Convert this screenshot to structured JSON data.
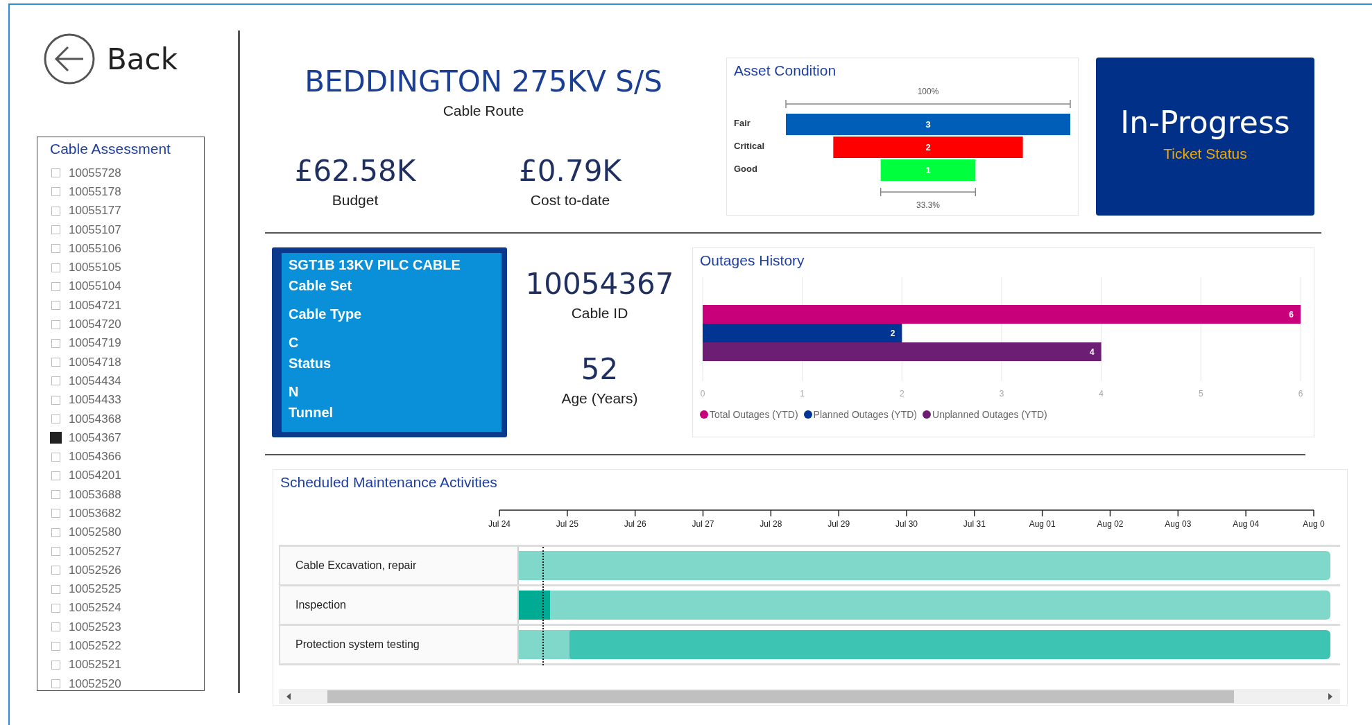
{
  "back_button": {
    "label": "Back"
  },
  "slicer": {
    "title": "Cable Assessment",
    "items": [
      {
        "label": "10055728",
        "checked": false
      },
      {
        "label": "10055178",
        "checked": false
      },
      {
        "label": "10055177",
        "checked": false
      },
      {
        "label": "10055107",
        "checked": false
      },
      {
        "label": "10055106",
        "checked": false
      },
      {
        "label": "10055105",
        "checked": false
      },
      {
        "label": "10055104",
        "checked": false
      },
      {
        "label": "10054721",
        "checked": false
      },
      {
        "label": "10054720",
        "checked": false
      },
      {
        "label": "10054719",
        "checked": false
      },
      {
        "label": "10054718",
        "checked": false
      },
      {
        "label": "10054434",
        "checked": false
      },
      {
        "label": "10054433",
        "checked": false
      },
      {
        "label": "10054368",
        "checked": false
      },
      {
        "label": "10054367",
        "checked": true
      },
      {
        "label": "10054366",
        "checked": false
      },
      {
        "label": "10054201",
        "checked": false
      },
      {
        "label": "10053688",
        "checked": false
      },
      {
        "label": "10053682",
        "checked": false
      },
      {
        "label": "10052580",
        "checked": false
      },
      {
        "label": "10052527",
        "checked": false
      },
      {
        "label": "10052526",
        "checked": false
      },
      {
        "label": "10052525",
        "checked": false
      },
      {
        "label": "10052524",
        "checked": false
      },
      {
        "label": "10052523",
        "checked": false
      },
      {
        "label": "10052522",
        "checked": false
      },
      {
        "label": "10052521",
        "checked": false
      },
      {
        "label": "10052520",
        "checked": false
      }
    ]
  },
  "header": {
    "title": "BEDDINGTON 275KV S/S",
    "subtitle": "Cable Route"
  },
  "kpis": [
    {
      "value": "£62.58K",
      "label": "Budget"
    },
    {
      "value": "£0.79K",
      "label": "Cost to-date"
    }
  ],
  "asset_condition": {
    "title": "Asset Condition",
    "top_percent": "100%",
    "stages": [
      {
        "label": "Fair",
        "value": "3",
        "color": "#005eb8"
      },
      {
        "label": "Critical",
        "value": "2",
        "color": "#ff0000"
      },
      {
        "label": "Good",
        "value": "1",
        "color": "#00ff3c"
      }
    ],
    "bottom_percent": "33.3%"
  },
  "ticket": {
    "value": "In-Progress",
    "label": "Ticket Status"
  },
  "cable_card": {
    "fields": [
      {
        "value": "SGT1B 13KV PILC CABLE",
        "label": "Cable Set"
      },
      {
        "label": "Cable Type"
      },
      {
        "value": "C",
        "label": "Status"
      },
      {
        "value": "N",
        "label": "Tunnel"
      }
    ]
  },
  "cable_id": {
    "value": "10054367",
    "label": "Cable ID"
  },
  "age": {
    "value": "52",
    "label": "Age (Years)"
  },
  "outages": {
    "title": "Outages History",
    "chart_data": {
      "type": "bar",
      "orientation": "horizontal",
      "xlim": [
        0,
        6
      ],
      "xticks": [
        0,
        1,
        2,
        3,
        4,
        5,
        6
      ],
      "grid": true,
      "data_labels": true,
      "series": [
        {
          "name": "Total Outages (YTD)",
          "color": "#c8007a",
          "values": [
            6
          ]
        },
        {
          "name": "Planned Outages (YTD)",
          "color": "#003593",
          "values": [
            2
          ]
        },
        {
          "name": "Unplanned Outages (YTD)",
          "color": "#6c1e75",
          "values": [
            4
          ]
        }
      ]
    }
  },
  "maintenance": {
    "title": "Scheduled Maintenance Activities",
    "ticks": [
      "Jul 24",
      "Jul 25",
      "Jul 26",
      "Jul 27",
      "Jul 28",
      "Jul 29",
      "Jul 30",
      "Jul 31",
      "Aug 01",
      "Aug 02",
      "Aug 03",
      "Aug 04",
      "Aug 0"
    ],
    "rows": [
      {
        "label": "Cable Excavation, repair",
        "kind": "planned"
      },
      {
        "label": "Inspection",
        "kind": "started"
      },
      {
        "label": "Protection system testing",
        "kind": "shifted"
      }
    ]
  }
}
